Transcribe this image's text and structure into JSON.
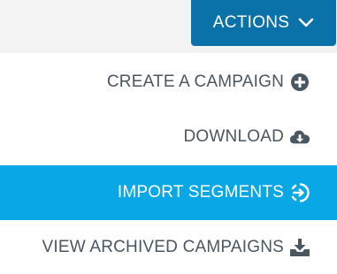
{
  "actions_button": {
    "label": "ACTIONS",
    "icon": "chevron-down-icon",
    "color": "#0a72a8"
  },
  "menu": {
    "items": [
      {
        "label": "CREATE A CAMPAIGN",
        "icon": "plus-circle-icon",
        "active": false
      },
      {
        "label": "DOWNLOAD",
        "icon": "cloud-download-icon",
        "active": false
      },
      {
        "label": "IMPORT SEGMENTS",
        "icon": "sign-in-icon",
        "active": true
      },
      {
        "label": "VIEW ARCHIVED CAMPAIGNS",
        "icon": "tray-download-icon",
        "active": false
      }
    ],
    "active_color": "#0aa7e6",
    "text_color": "#4a5660"
  }
}
